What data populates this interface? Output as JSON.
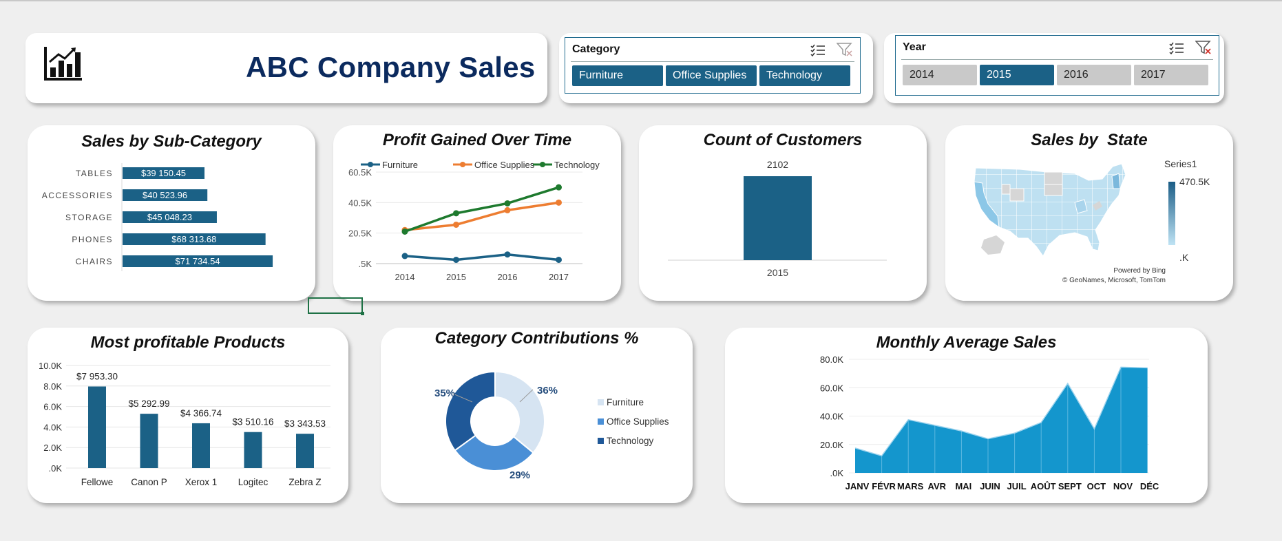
{
  "header": {
    "title": "ABC Company Sales",
    "logo_icon": "bar-chart-icon"
  },
  "category_slicer": {
    "title": "Category",
    "options": [
      {
        "label": "Furniture",
        "selected": true
      },
      {
        "label": "Office Supplies",
        "selected": true
      },
      {
        "label": "Technology",
        "selected": true
      }
    ]
  },
  "year_slicer": {
    "title": "Year",
    "options": [
      {
        "label": "2014",
        "selected": false
      },
      {
        "label": "2015",
        "selected": true
      },
      {
        "label": "2016",
        "selected": false
      },
      {
        "label": "2017",
        "selected": false
      }
    ]
  },
  "colors": {
    "primary": "#1b6186",
    "orange": "#ed7d31",
    "green": "#1e7a2e",
    "navy": "#0b2a5e",
    "area": "#1496cd"
  },
  "chart_data": [
    {
      "id": "subcat",
      "type": "bar",
      "orientation": "horizontal",
      "title": "Sales by Sub-Category",
      "categories": [
        "TABLES",
        "ACCESSORIES",
        "STORAGE",
        "PHONES",
        "CHAIRS"
      ],
      "values": [
        39150.45,
        40523.96,
        45048.23,
        68313.68,
        71734.54
      ],
      "labels": [
        "$39 150.45",
        "$40 523.96",
        "$45 048.23",
        "$68 313.68",
        "$71 734.54"
      ]
    },
    {
      "id": "profit",
      "type": "line",
      "title": "Profit Gained Over Time",
      "x": [
        "2014",
        "2015",
        "2016",
        "2017"
      ],
      "yticks": [
        ".5K",
        "20.5K",
        "40.5K",
        "60.5K"
      ],
      "ylim": [
        500,
        60500
      ],
      "series": [
        {
          "name": "Furniture",
          "color": "#1b6186",
          "values": [
            5500,
            3000,
            6500,
            3000
          ]
        },
        {
          "name": "Office Supplies",
          "color": "#ed7d31",
          "values": [
            22500,
            26000,
            35500,
            40500
          ]
        },
        {
          "name": "Technology",
          "color": "#1e7a2e",
          "values": [
            21500,
            33500,
            40000,
            50500
          ]
        }
      ],
      "legend": "top"
    },
    {
      "id": "customers",
      "type": "bar",
      "title": "Count of Customers",
      "categories": [
        "2015"
      ],
      "values": [
        2102
      ],
      "labels": [
        "2102"
      ]
    },
    {
      "id": "states",
      "type": "map",
      "title": "Sales by  State",
      "legend_title": "Series1",
      "legend_max": "470.5K",
      "legend_min": ".K",
      "credit_1": "Powered by Bing",
      "credit_2": "© GeoNames, Microsoft, TomTom"
    },
    {
      "id": "products",
      "type": "bar",
      "title": "Most profitable Products",
      "categories": [
        "Fellowe",
        "Canon P",
        "Xerox 1",
        "Logitec",
        "Zebra Z"
      ],
      "values": [
        7953.3,
        5292.99,
        4366.74,
        3510.16,
        3343.53
      ],
      "labels": [
        "$7 953.30",
        "$5 292.99",
        "$4 366.74",
        "$3 510.16",
        "$3 343.53"
      ],
      "yticks": [
        ".0K",
        "2.0K",
        "4.0K",
        "6.0K",
        "8.0K",
        "10.0K"
      ],
      "ylim": [
        0,
        10000
      ]
    },
    {
      "id": "contrib",
      "type": "pie",
      "donut": true,
      "title": "Category Contributions %",
      "labels": [
        "Furniture",
        "Office Supplies",
        "Technology"
      ],
      "values": [
        36,
        29,
        35
      ],
      "value_labels": [
        "36%",
        "29%",
        "35%"
      ],
      "colors": [
        "#d6e4f2",
        "#4a8fd6",
        "#1f5898"
      ],
      "legend": "right"
    },
    {
      "id": "monthly",
      "type": "area",
      "title": "Monthly Average Sales",
      "x": [
        "JANV",
        "FÉVR",
        "MARS",
        "AVR",
        "MAI",
        "JUIN",
        "JUIL",
        "AOÛT",
        "SEPT",
        "OCT",
        "NOV",
        "DÉC"
      ],
      "values": [
        17500,
        12000,
        37500,
        33500,
        29500,
        24000,
        28000,
        35500,
        63000,
        31000,
        74500,
        74000
      ],
      "yticks": [
        ".0K",
        "20.0K",
        "40.0K",
        "60.0K",
        "80.0K"
      ],
      "ylim": [
        0,
        80000
      ]
    }
  ]
}
